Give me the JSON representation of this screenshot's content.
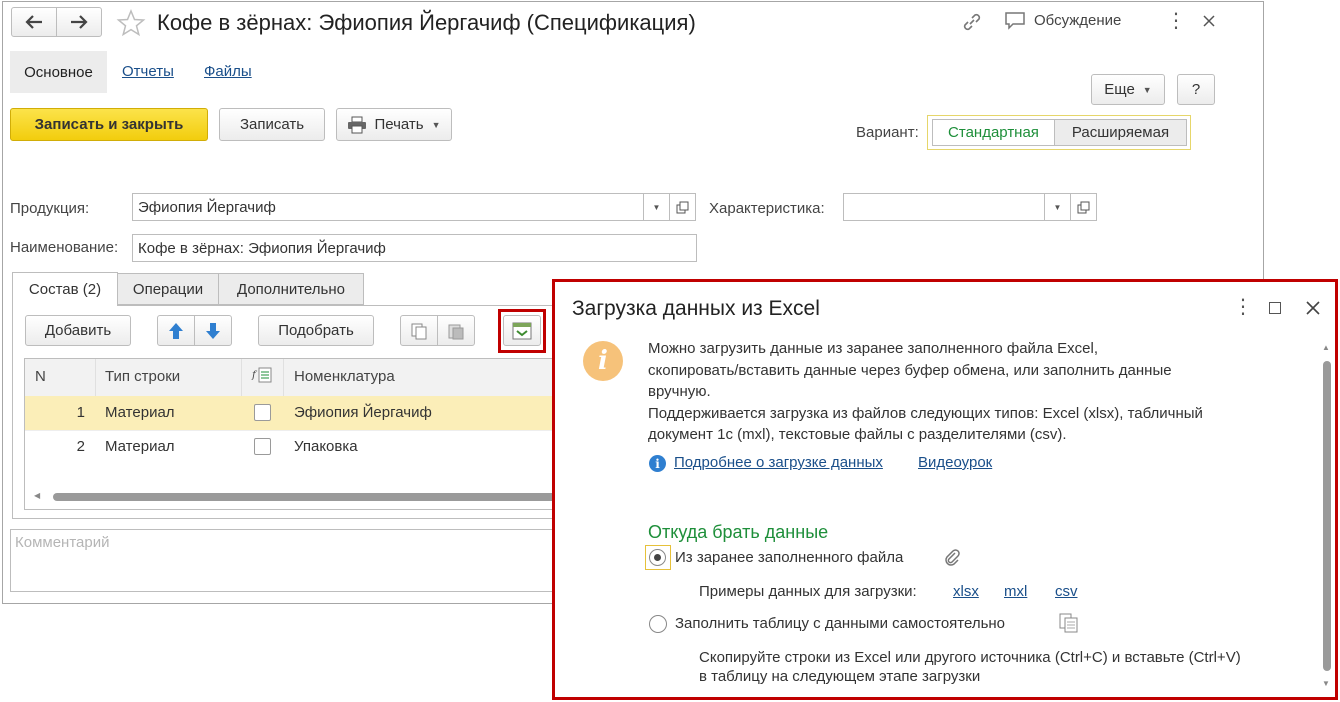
{
  "window": {
    "title": "Кофе в зёрнах: Эфиопия Йергачиф (Спецификация)",
    "discussion": "Обсуждение"
  },
  "nav_tabs": [
    "Основное",
    "Отчеты",
    "Файлы"
  ],
  "toolbar": {
    "save_close": "Записать и закрыть",
    "save": "Записать",
    "print": "Печать",
    "more": "Еще",
    "help": "?"
  },
  "variant": {
    "label": "Вариант:",
    "options": [
      "Стандартная",
      "Расширяемая"
    ]
  },
  "form": {
    "product_label": "Продукция:",
    "product_value": "Эфиопия Йергачиф",
    "char_label": "Характеристика:",
    "char_value": "",
    "name_label": "Наименование:",
    "name_value": "Кофе в зёрнах: Эфиопия Йергачиф",
    "comment_placeholder": "Комментарий"
  },
  "tabs": [
    "Состав (2)",
    "Операции",
    "Дополнительно"
  ],
  "table_toolbar": {
    "add": "Добавить",
    "pick": "Подобрать"
  },
  "table": {
    "headers": [
      "N",
      "Тип строки",
      "",
      "Номенклатура"
    ],
    "rows": [
      {
        "n": "1",
        "type": "Материал",
        "item": "Эфиопия Йергачиф"
      },
      {
        "n": "2",
        "type": "Материал",
        "item": "Упаковка"
      }
    ]
  },
  "dialog": {
    "title": "Загрузка данных из Excel",
    "intro": [
      "Можно загрузить данные из заранее заполненного файла Excel,",
      "скопировать/вставить данные через буфер обмена, или заполнить данные",
      "вручную.",
      "Поддерживается загрузка из файлов следующих типов: Excel (xlsx), табличный",
      "документ 1с (mxl), текстовые файлы с разделителями (csv)."
    ],
    "link_more": "Подробнее о загрузке данных",
    "link_video": "Видеоурок",
    "section_title": "Откуда брать данные",
    "option_file": "Из заранее заполненного файла",
    "examples_label": "Примеры данных для загрузки:",
    "examples": [
      "xlsx",
      "mxl",
      "csv"
    ],
    "option_manual": "Заполнить таблицу с данными самостоятельно",
    "manual_hint": [
      "Скопируйте строки из Excel или другого источника (Ctrl+C) и вставьте (Ctrl+V)",
      "в таблицу на следующем этапе загрузки"
    ]
  },
  "colors": {
    "accent_yellow": "#f7d117",
    "highlight_red": "#c00000",
    "green": "#1e8f3a",
    "link_blue": "#1a4f8a",
    "selected_row": "#fbeeb8"
  }
}
